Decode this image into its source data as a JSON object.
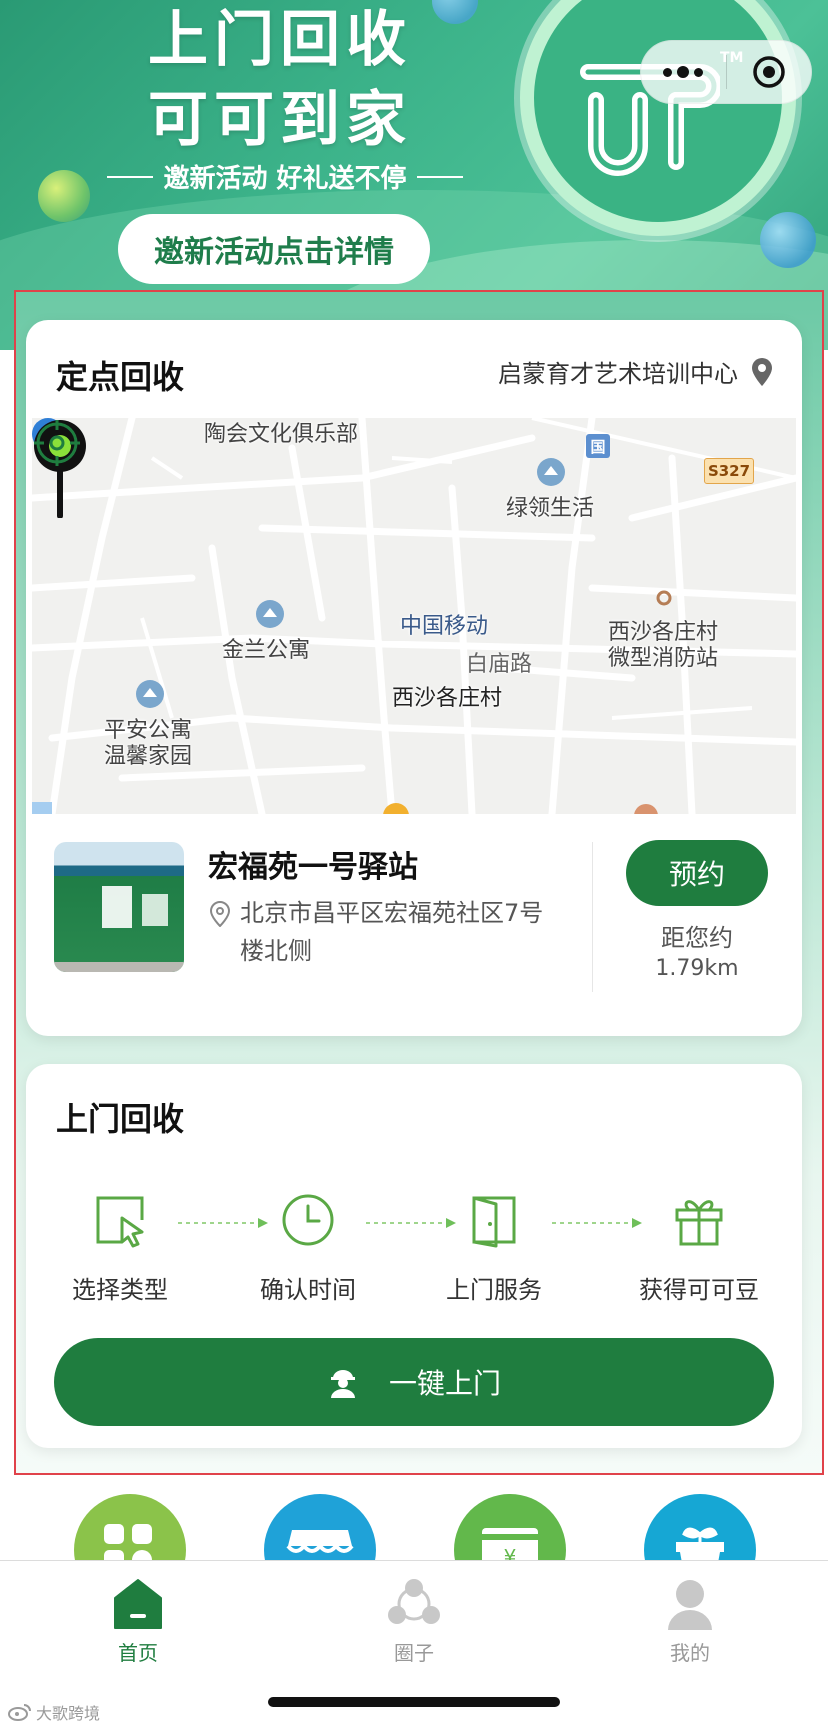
{
  "banner": {
    "title_line1": "上门回收",
    "title_line2": "可可到家",
    "subtitle": "邀新活动 好礼送不停",
    "detail_button": "邀新活动点击详情",
    "logo_tm": "TM"
  },
  "fixed_recycle": {
    "title": "定点回收",
    "location": "启蒙育才艺术培训中心",
    "map_labels": {
      "taohui": "陶会文化俱乐部",
      "lvling": "绿领生活",
      "s327": "S327",
      "jinlan": "金兰公寓",
      "mobile": "中国移动",
      "baimiao": "白庙路",
      "xisha_fire_1": "西沙各庄村",
      "xisha_fire_2": "微型消防站",
      "xisha_village": "西沙各庄村",
      "pingan_1": "平安公寓",
      "pingan_2": "温馨家园",
      "national": "国"
    },
    "station": {
      "name": "宏福苑一号驿站",
      "address": "北京市昌平区宏福苑社区7号楼北侧",
      "book_button": "预约",
      "distance_label": "距您约",
      "distance_value": "1.79km"
    }
  },
  "door_recycle": {
    "title": "上门回收",
    "steps": [
      {
        "label": "选择类型",
        "icon": "cursor-select-icon"
      },
      {
        "label": "确认时间",
        "icon": "clock-icon"
      },
      {
        "label": "上门服务",
        "icon": "door-icon"
      },
      {
        "label": "获得可可豆",
        "icon": "gift-icon"
      }
    ],
    "cta_label": "一键上门"
  },
  "tabbar": {
    "items": [
      {
        "label": "首页",
        "icon": "home-icon",
        "active": true
      },
      {
        "label": "圈子",
        "icon": "circle-group-icon",
        "active": false
      },
      {
        "label": "我的",
        "icon": "profile-icon",
        "active": false
      }
    ]
  },
  "watermark": "大歌跨境",
  "colors": {
    "brand_green": "#1f7d3f",
    "banner_green": "#3cb38a",
    "highlight_red": "#e0424a"
  }
}
